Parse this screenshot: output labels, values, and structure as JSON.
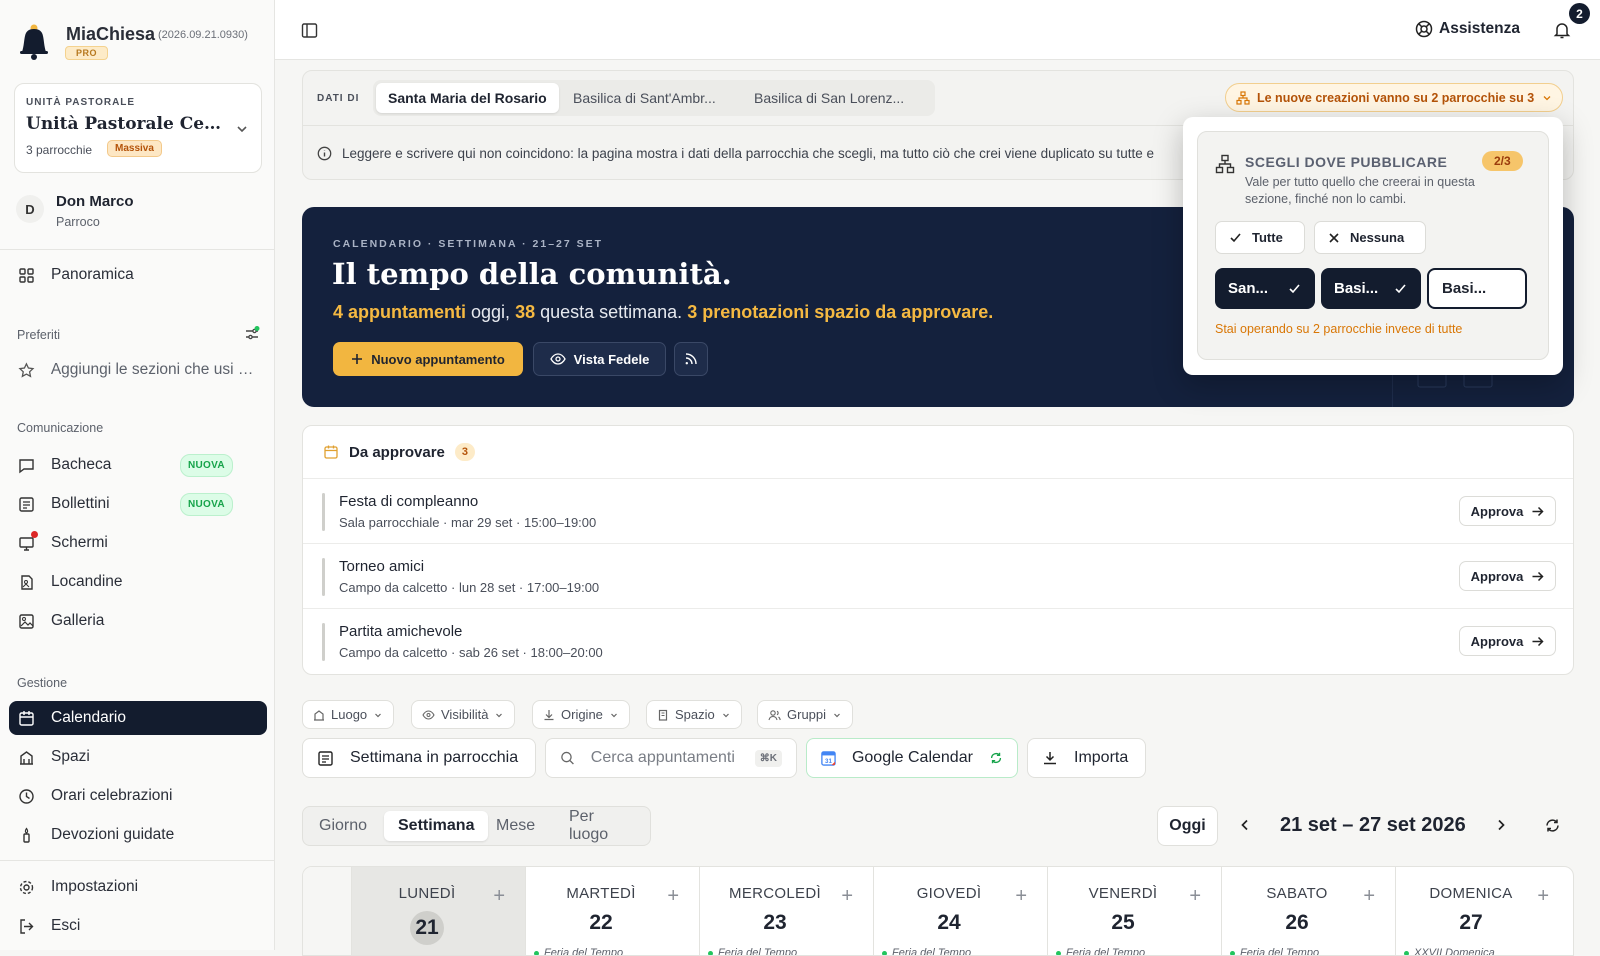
{
  "app": {
    "name": "MiaChiesa",
    "version": "(2026.09.21.0930)",
    "plan": "PRO"
  },
  "unit": {
    "eyebrow": "UNITÀ PASTORALE",
    "name": "Unità Pastorale Centro Storico",
    "count": "3 parrocchie",
    "badge": "Massiva"
  },
  "user": {
    "initial": "D",
    "name": "Don Marco",
    "role": "Parroco"
  },
  "sidebar": {
    "overview": "Panoramica",
    "favorites_label": "Preferiti",
    "favorites_hint": "Aggiungi le sezioni che usi di più",
    "comm_label": "Comunicazione",
    "comm_items": [
      {
        "label": "Bacheca",
        "badge": "NUOVA"
      },
      {
        "label": "Bollettini",
        "badge": "NUOVA"
      },
      {
        "label": "Schermi"
      },
      {
        "label": "Locandine"
      },
      {
        "label": "Galleria"
      }
    ],
    "manage_label": "Gestione",
    "manage_items": [
      {
        "label": "Calendario",
        "active": true
      },
      {
        "label": "Spazi"
      },
      {
        "label": "Orari celebrazioni"
      },
      {
        "label": "Devozioni guidate"
      }
    ],
    "settings": "Impostazioni",
    "logout": "Esci"
  },
  "topbar": {
    "help": "Assistenza",
    "notifications": "2"
  },
  "dati": {
    "label": "DATI DI",
    "tabs": [
      "Santa Maria del Rosario",
      "Basilica di Sant'Ambr...",
      "Basilica di San Lorenz..."
    ],
    "selected": 0,
    "multi_pill": "Le nuove creazioni vanno su 2 parrocchie su 3",
    "info": "Leggere e scrivere qui non coincidono: la pagina mostra i dati della parrocchia che scegli, ma tutto ciò che crei viene duplicato su tutte e"
  },
  "hero": {
    "eyebrow": "CALENDARIO · SETTIMANA · 21–27 SET",
    "title": "Il tempo della comunità.",
    "sub_today": "4 appuntamenti",
    "sub_mid1": " oggi, ",
    "sub_week": "38",
    "sub_mid2": " questa settimana. ",
    "sub_pending": "3 prenotazioni spazio da approvare.",
    "btn_new": "Nuovo appuntamento",
    "btn_view": "Vista Fedele"
  },
  "popover": {
    "title": "SCEGLI DOVE PUBBLICARE",
    "count": "2/3",
    "desc": "Vale per tutto quello che creerai in questa sezione, finché non lo cambi.",
    "all": "Tutte",
    "none": "Nessuna",
    "parishes": [
      {
        "label": "San...",
        "selected": true
      },
      {
        "label": "Basi...",
        "selected": true
      },
      {
        "label": "Basi...",
        "selected": false
      }
    ],
    "note": "Stai operando su 2 parrocchie invece di tutte"
  },
  "approvals": {
    "title": "Da approvare",
    "count": "3",
    "action": "Approva",
    "items": [
      {
        "name": "Festa di compleanno",
        "meta": "Sala parrocchiale · mar 29 set · 15:00–19:00"
      },
      {
        "name": "Torneo amici",
        "meta": "Campo da calcetto · lun 28 set · 17:00–19:00"
      },
      {
        "name": "Partita amichevole",
        "meta": "Campo da calcetto · sab 26 set · 18:00–20:00"
      }
    ]
  },
  "filters": [
    "Luogo",
    "Visibilità",
    "Origine",
    "Spazio",
    "Gruppi"
  ],
  "toolbar": {
    "week": "Settimana in parrocchia",
    "search_placeholder": "Cerca appuntamenti",
    "shortcut": "⌘K",
    "gcal": "Google Calendar",
    "import": "Importa"
  },
  "views": {
    "items": [
      "Giorno",
      "Settimana",
      "Mese",
      "Per luogo"
    ],
    "selected": 1
  },
  "nav": {
    "today": "Oggi",
    "range": "21 set – 27 set 2026"
  },
  "week": [
    {
      "name": "LUNEDÌ",
      "num": "21",
      "today": true,
      "tag": ""
    },
    {
      "name": "MARTEDÌ",
      "num": "22",
      "tag": "Feria del Tempo"
    },
    {
      "name": "MERCOLEDÌ",
      "num": "23",
      "tag": "Feria del Tempo"
    },
    {
      "name": "GIOVEDÌ",
      "num": "24",
      "tag": "Feria del Tempo"
    },
    {
      "name": "VENERDÌ",
      "num": "25",
      "tag": "Feria del Tempo"
    },
    {
      "name": "SABATO",
      "num": "26",
      "tag": "Feria del Tempo"
    },
    {
      "name": "DOMENICA",
      "num": "27",
      "tag": "XXVII Domenica"
    }
  ],
  "colors": {
    "navy": "#14213d",
    "accent": "#f2b640",
    "warning": "#d97706",
    "success": "#16a34a"
  }
}
